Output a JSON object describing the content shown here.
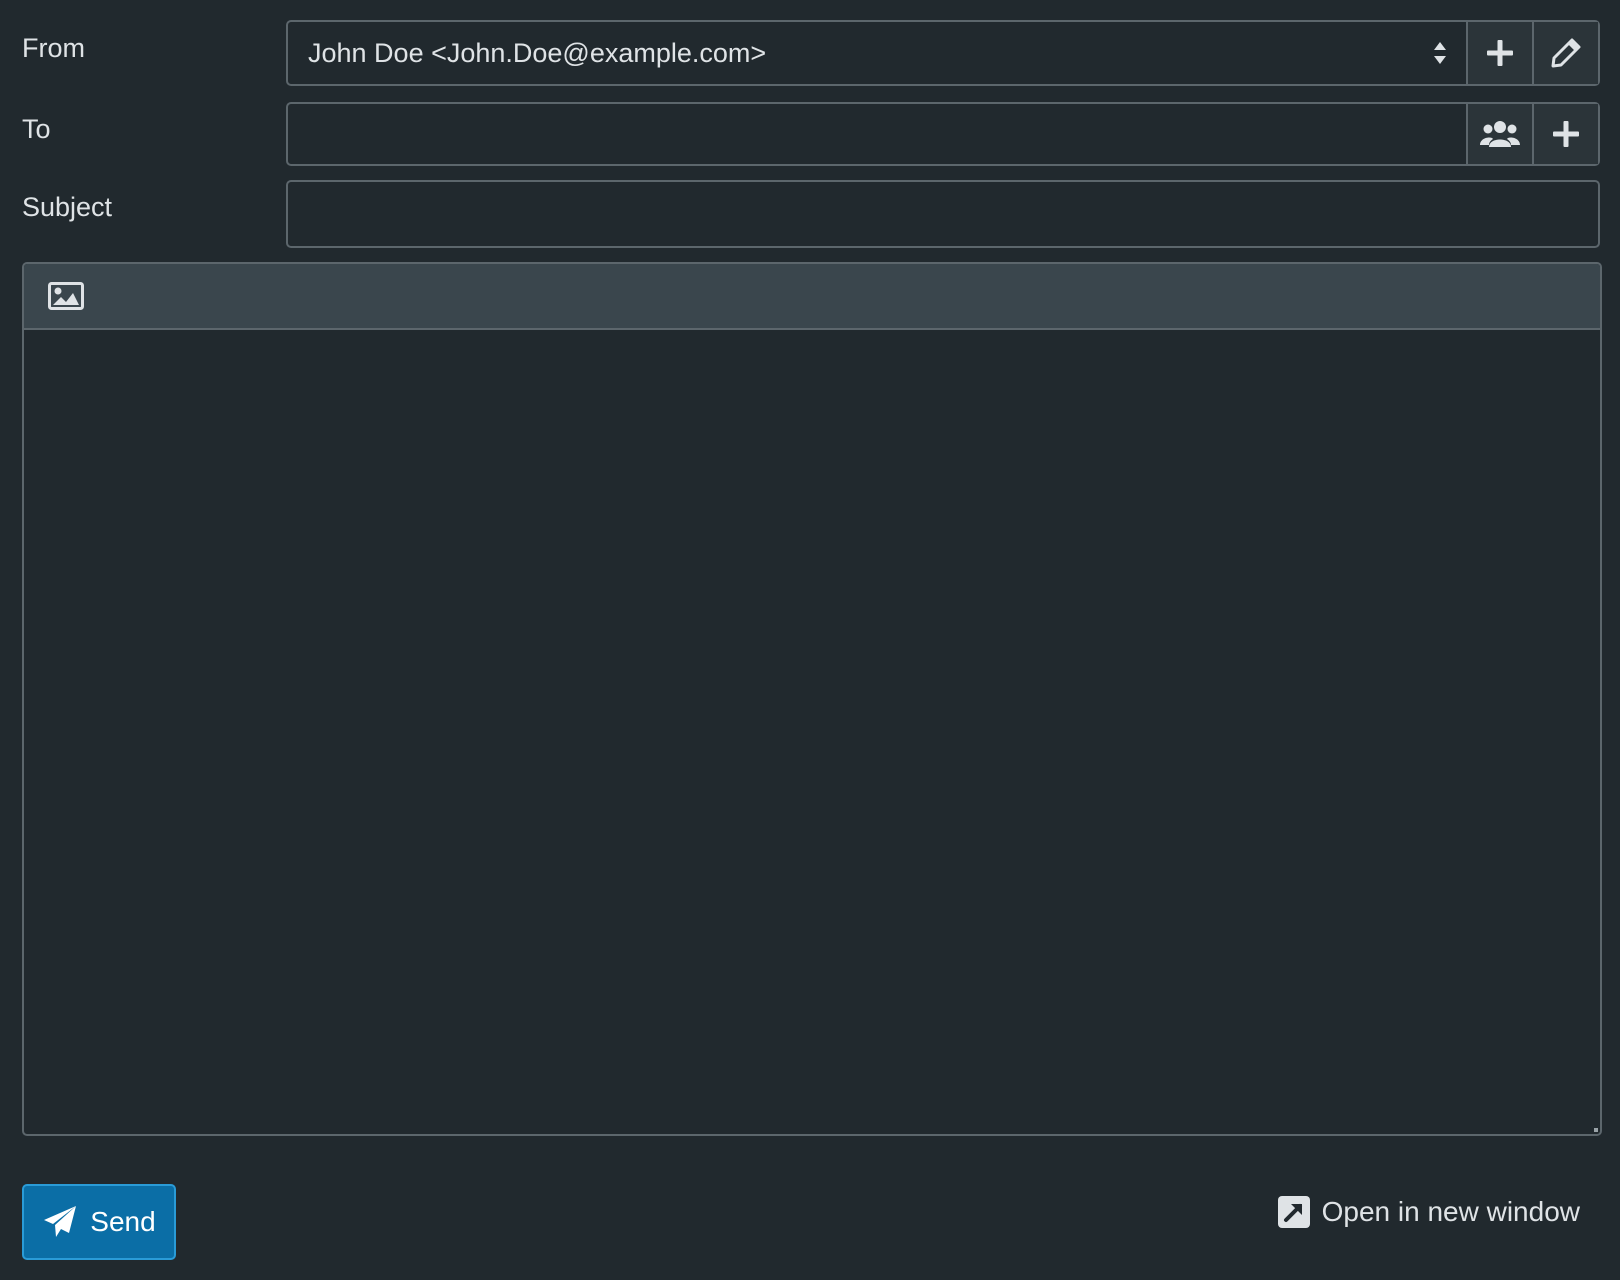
{
  "form": {
    "from_label": "From",
    "to_label": "To",
    "subject_label": "Subject",
    "from_value": "John Doe <John.Doe@example.com>",
    "to_value": "",
    "subject_value": ""
  },
  "icons": {
    "select_arrows": "sort-icon",
    "add_identity": "plus-icon",
    "edit_identity": "pencil-icon",
    "address_book": "users-icon",
    "add_recipient": "plus-icon",
    "insert_image": "image-icon",
    "send": "paper-plane-icon",
    "open_window": "external-link-icon"
  },
  "footer": {
    "send_label": "Send",
    "open_new_window_label": "Open in new window"
  },
  "colors": {
    "background": "#21292e",
    "border": "#5c666c",
    "toolbar": "#3a464d",
    "primary": "#0b6ea6"
  }
}
